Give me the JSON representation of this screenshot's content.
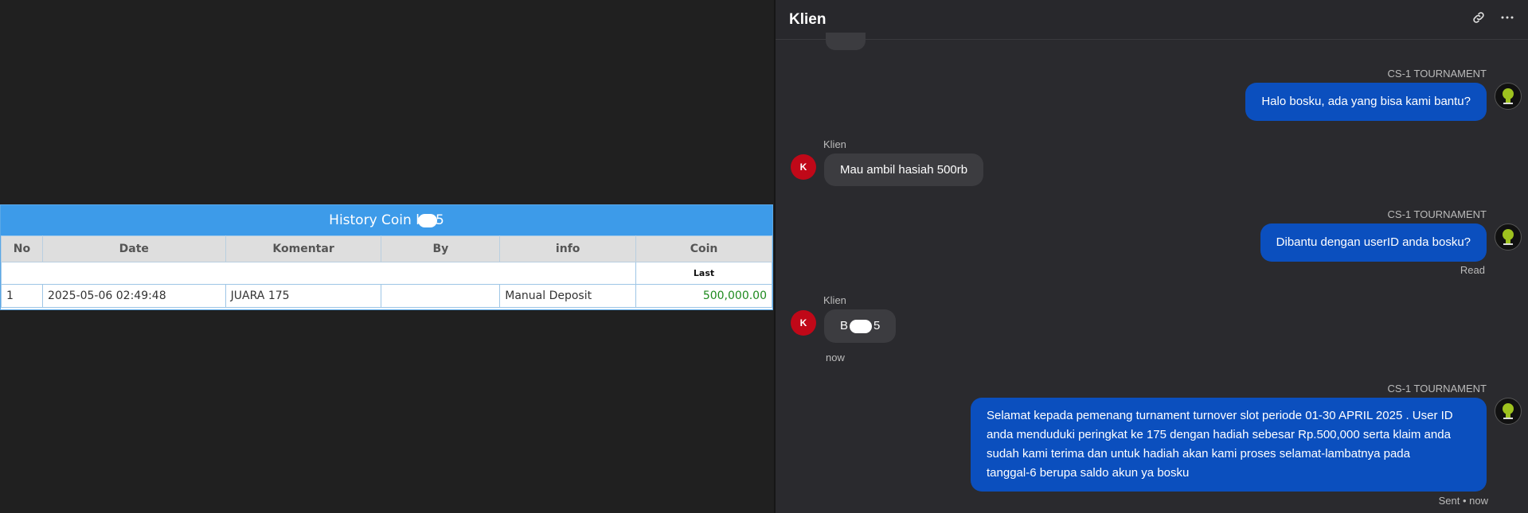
{
  "history": {
    "title_prefix": "History Coin b",
    "title_suffix": "5",
    "columns": [
      "No",
      "Date",
      "Komentar",
      "By",
      "info",
      "Coin"
    ],
    "coin_subheader": "Last",
    "rows": [
      {
        "no": "1",
        "date": "2025-05-06 02:49:48",
        "komentar": "JUARA 175",
        "by": "",
        "info": "Manual Deposit",
        "coin": "500,000.00"
      }
    ]
  },
  "chat": {
    "title": "Klien",
    "header_icons": [
      "link-icon",
      "more-icon"
    ],
    "messages": [
      {
        "sender": "CS-1 TOURNAMENT",
        "text": "Halo bosku, ada yang bisa kami bantu?"
      },
      {
        "sender": "Klien",
        "avatar": "K",
        "text": "Mau ambil hasiah 500rb"
      },
      {
        "sender": "CS-1 TOURNAMENT",
        "text": "Dibantu dengan userID anda bosku?",
        "status": "Read"
      },
      {
        "sender": "Klien",
        "avatar": "K",
        "text_prefix": "B",
        "text_suffix": "5",
        "time": "now"
      },
      {
        "sender": "CS-1 TOURNAMENT",
        "text_lines": [
          "Selamat kepada pemenang turnament turnover slot periode 01-30 APRIL 2025 . User ID",
          "anda menduduki peringkat ke 175 dengan hadiah sebesar Rp.500,000 serta klaim anda",
          "sudah kami terima dan untuk hadiah akan kami proses selamat-lambatnya pada",
          "tanggal-6 berupa saldo akun ya bosku"
        ],
        "status": "Sent • now"
      }
    ]
  },
  "colors": {
    "accent_blue": "#0b4fbe",
    "table_header_blue": "#3d9be9",
    "avatar_red": "#c00818",
    "coin_green": "#1e8a1e"
  }
}
